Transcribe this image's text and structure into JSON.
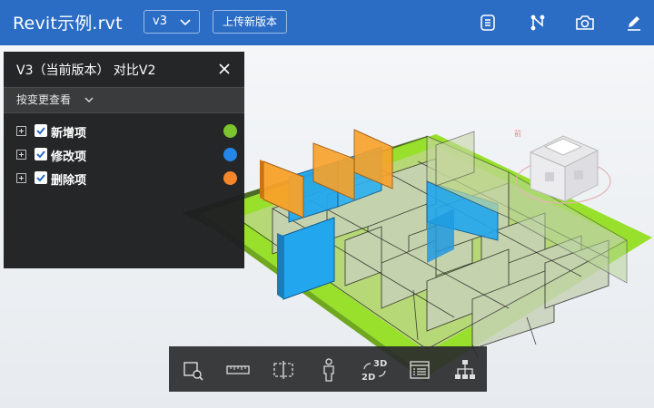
{
  "header": {
    "title": "Revit示例.rvt",
    "version": "v3",
    "upload_label": "上传新版本",
    "icons": [
      "list-icon",
      "graph-icon",
      "camera-icon",
      "pen-icon"
    ]
  },
  "panel": {
    "title": "V3（当前版本） 对比V2",
    "filter_label": "按变更查看",
    "items": [
      {
        "label": "新增项",
        "color": "#7cc42d",
        "checked": true
      },
      {
        "label": "修改项",
        "color": "#2486e8",
        "checked": true
      },
      {
        "label": "删除项",
        "color": "#f5862a",
        "checked": true
      }
    ]
  },
  "viewcube": {
    "face": "前"
  },
  "toolbar": {
    "tools": [
      "zoom-region-icon",
      "measure-icon",
      "section-box-icon",
      "person-view-icon",
      "view-2d-3d-icon",
      "properties-icon",
      "model-tree-icon"
    ],
    "toggle_3d": "3D",
    "toggle_2d": "2D"
  },
  "colors": {
    "header": "#2b6cc4",
    "added": "#7cc42d",
    "modified": "#2486e8",
    "deleted": "#f5862a"
  }
}
